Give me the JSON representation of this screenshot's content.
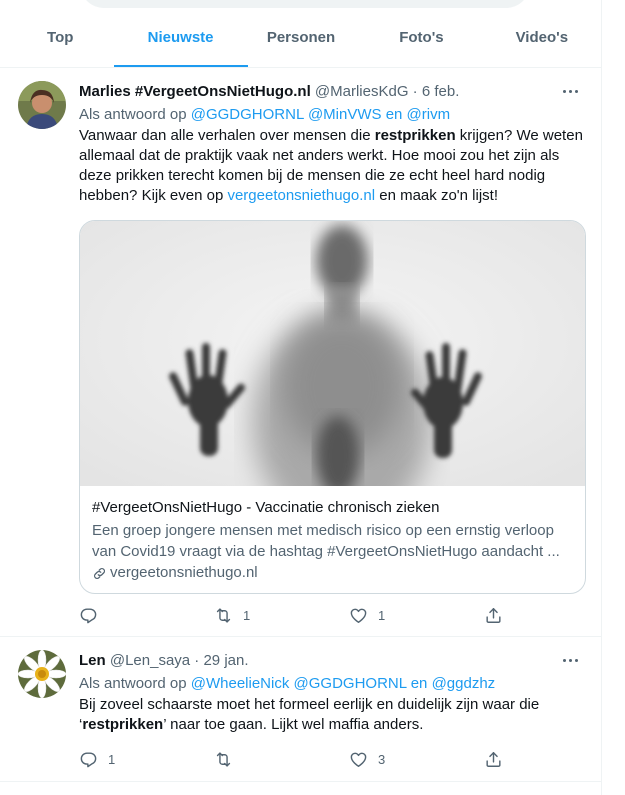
{
  "tabs": [
    "Top",
    "Nieuwste",
    "Personen",
    "Foto's",
    "Video's"
  ],
  "active_tab": "Nieuwste",
  "tweets": [
    {
      "name": "Marlies #VergeetOnsNietHugo.nl",
      "handle": "@MarliesKdG",
      "sep": "·",
      "date": "6 feb.",
      "reply_prefix": "Als antwoord op",
      "reply_1": "@GGDGHORNL",
      "reply_2": "@MinVWS",
      "reply_and": "en",
      "reply_3": "@rivm",
      "text_1": "Vanwaar dan alle verhalen over mensen die ",
      "text_bold": "restprikken",
      "text_2": " krijgen? We weten allemaal dat de praktijk vaak net anders werkt. Hoe mooi zou het zijn als deze prikken terecht komen bij de mensen die ze echt heel hard nodig hebben? Kijk even op ",
      "text_link": "vergeetonsniethugo.nl",
      "text_3": " en maak zo'n lijst!",
      "card": {
        "title": "#VergeetOnsNietHugo - Vaccinatie chronisch zieken",
        "description": "Een groep jongere mensen met medisch risico op een ernstig verloop van Covid19 vraagt via de hashtag #VergeetOnsNietHugo aandacht ...",
        "domain": "vergeetonsniethugo.nl"
      },
      "replies": "",
      "retweets": "1",
      "likes": "1"
    },
    {
      "name": "Len",
      "handle": "@Len_saya",
      "sep": "·",
      "date": "29 jan.",
      "reply_prefix": "Als antwoord op",
      "reply_1": "@WheelieNick",
      "reply_2": "@GGDGHORNL",
      "reply_and": "en",
      "reply_3": "@ggdzhz",
      "text_1": "Bij zoveel schaarste moet het formeel eerlijk en duidelijk zijn waar die ‘",
      "text_bold": "restprikken",
      "text_2": "’ naar toe gaan. Lijkt wel maffia anders.",
      "replies": "1",
      "retweets": "",
      "likes": "3"
    }
  ],
  "colors": {
    "accent": "#1d9bf0",
    "muted": "#536471",
    "text": "#0f1419",
    "border": "#eff3f4"
  },
  "icons": [
    "more-icon",
    "reply-icon",
    "retweet-icon",
    "like-icon",
    "share-icon",
    "link-icon"
  ]
}
